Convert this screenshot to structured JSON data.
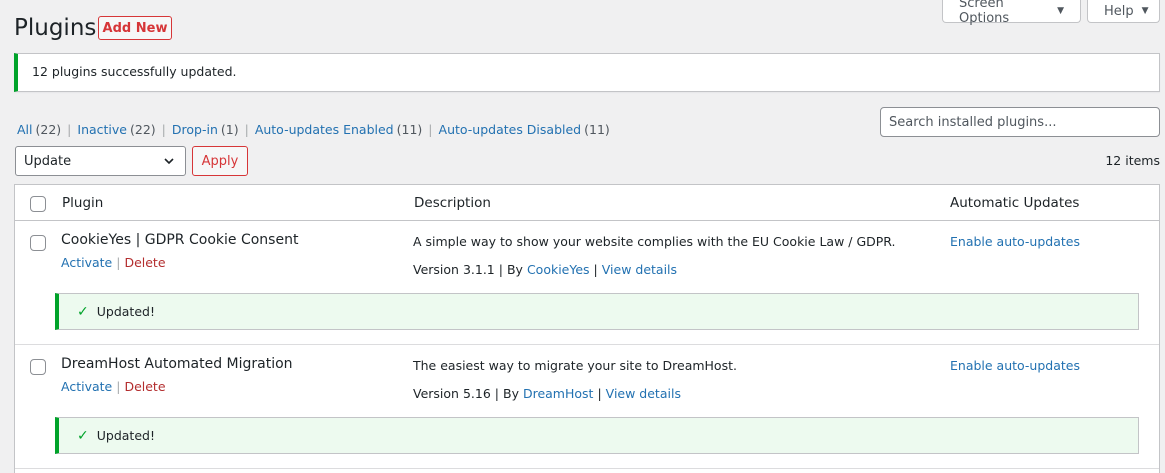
{
  "header": {
    "title": "Plugins",
    "add_new_label": "Add New"
  },
  "top_tabs": {
    "screen_options": "Screen Options",
    "help": "Help"
  },
  "notice": {
    "message": "12 plugins successfully updated."
  },
  "filters": {
    "all": {
      "label": "All",
      "count": "(22)"
    },
    "inactive": {
      "label": "Inactive",
      "count": "(22)"
    },
    "dropin": {
      "label": "Drop-in",
      "count": "(1)"
    },
    "auto_enabled": {
      "label": "Auto-updates Enabled",
      "count": "(11)"
    },
    "auto_disabled": {
      "label": "Auto-updates Disabled",
      "count": "(11)"
    }
  },
  "search": {
    "placeholder": "Search installed plugins..."
  },
  "bulk": {
    "selected": "Update",
    "apply_label": "Apply",
    "items_count": "12 items"
  },
  "table": {
    "columns": {
      "plugin": "Plugin",
      "description": "Description",
      "auto_updates": "Automatic Updates"
    },
    "rows": [
      {
        "name": "CookieYes | GDPR Cookie Consent",
        "activate": "Activate",
        "delete": "Delete",
        "description": "A simple way to show your website complies with the EU Cookie Law / GDPR.",
        "version": "Version 3.1.1",
        "by": "By",
        "author": "CookieYes",
        "view_details": "View details",
        "auto_update_link": "Enable auto-updates",
        "update_status": "Updated!"
      },
      {
        "name": "DreamHost Automated Migration",
        "activate": "Activate",
        "delete": "Delete",
        "description": "The easiest way to migrate your site to DreamHost.",
        "version": "Version 5.16",
        "by": "By",
        "author": "DreamHost",
        "view_details": "View details",
        "auto_update_link": "Enable auto-updates",
        "update_status": "Updated!"
      }
    ]
  },
  "colors": {
    "link": "#2271b1",
    "danger": "#d63638",
    "success": "#00a32a"
  }
}
